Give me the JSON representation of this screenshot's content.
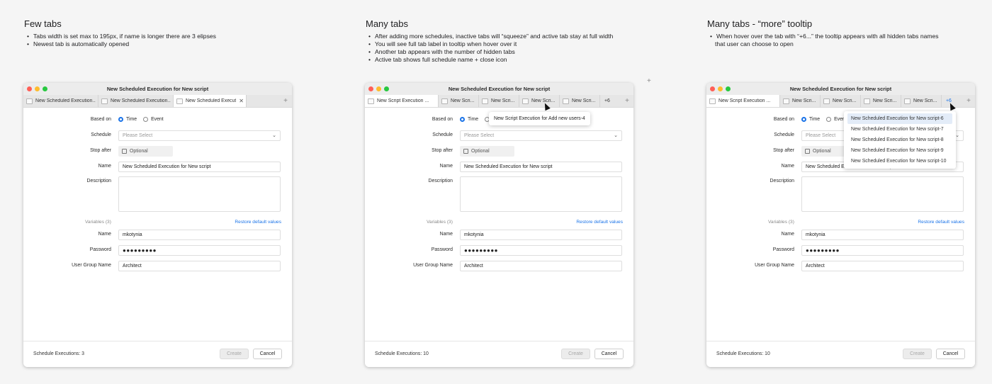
{
  "notes": [
    {
      "title": "Few tabs",
      "bullets": [
        "Tabs width is set max to 195px, if name is longer there are 3 elipses",
        "Newest tab is automatically opened"
      ]
    },
    {
      "title": "Many tabs",
      "bullets": [
        "After adding more schedules, inactive tabs will “squeeze” and active tab stay at full width",
        "You will see full tab label in tooltip when hover over it",
        "Another tab appears with the number of hidden tabs",
        "Active tab shows full schedule name + close icon"
      ]
    },
    {
      "title": "Many tabs - “more” tooltip",
      "bullets": [
        "When hover over the tab with “+6...” the tooltip appears with all hidden tabs names",
        "that user can choose to open"
      ]
    }
  ],
  "window_title": "New Scheduled Execution for New script",
  "windows": [
    {
      "tabs": [
        "New Scheduled Execution...",
        "New Scheduled Execution...",
        "New Scheduled Executi..."
      ],
      "footer_count": "Schedule Executions: 3"
    },
    {
      "tabs": [
        "New Script Execution ...",
        "New Scri...",
        "New Scri...",
        "New Scri...",
        "New Scri..."
      ],
      "more_tab": "+6",
      "tooltip": "New Script Execution for Add new users-4",
      "footer_count": "Schedule Executions: 10"
    },
    {
      "tabs": [
        "New Script Execution ...",
        "New Scri...",
        "New Scri...",
        "New Scri...",
        "New Scri..."
      ],
      "more_tab": "+6",
      "dropdown": [
        "New Scheduled Execution for New script-6",
        "New Scheduled Execution for New script-7",
        "New Scheduled Execution for New script-8",
        "New Scheduled Execution for New script-9",
        "New Scheduled Execution for New script-10"
      ],
      "footer_count": "Schedule Executions: 10"
    }
  ],
  "form": {
    "based_on_label": "Based on",
    "radio_time": "Time",
    "radio_event": "Event",
    "schedule_label": "Schedule",
    "schedule_placeholder": "Please Select",
    "stop_after_label": "Stop after",
    "stop_after_placeholder": "Optional",
    "name_label": "Name",
    "name_value": "New Scheduled Execution for New script",
    "description_label": "Description",
    "variables_label": "Variables (3)",
    "restore_label": "Restore default values",
    "var_name_label": "Name",
    "var_name_value": "mkotynia",
    "password_label": "Password",
    "password_value": "●●●●●●●●●",
    "group_label": "User Group Name",
    "group_value": "Architect",
    "create_label": "Create",
    "cancel_label": "Cancel"
  },
  "colors": {
    "accent": "#1a73e8",
    "close": "#ff5f57",
    "minimize": "#febc2e",
    "zoom": "#28c840"
  }
}
